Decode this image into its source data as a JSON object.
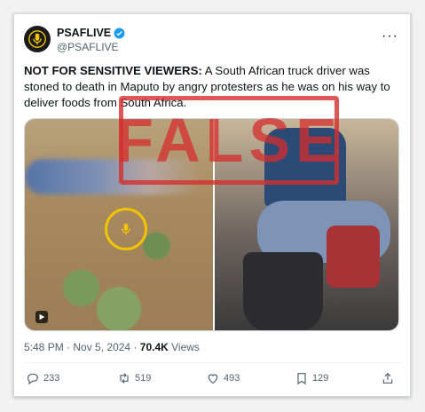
{
  "tweet": {
    "display_name": "PSAFLIVE",
    "handle": "@PSAFLIVE",
    "more_label": "···",
    "text_bold": "NOT FOR SENSITIVE VIEWERS:",
    "text_rest": " A South African truck driver was stoned to death in Maputo by angry protesters as he was on his way to deliver foods from South Africa.",
    "time": "5:48 PM",
    "separator": " · ",
    "date": "Nov 5, 2024",
    "views_count": "70.4K",
    "views_label": " Views"
  },
  "stamp": {
    "label": "FALSE",
    "color": "#d62e2e"
  },
  "actions": {
    "replies": "233",
    "reposts": "519",
    "likes": "493",
    "bookmarks": "129"
  },
  "icons": [
    "verified-badge-icon",
    "play-icon",
    "reply-icon",
    "repost-icon",
    "like-icon",
    "bookmark-icon",
    "share-icon"
  ],
  "colors": {
    "verified": "#1d9bf0",
    "text": "#0f1419",
    "muted": "#536471"
  }
}
